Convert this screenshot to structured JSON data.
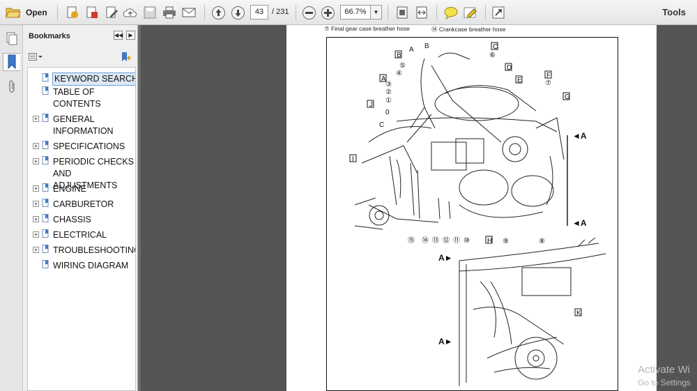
{
  "toolbar": {
    "open_label": "Open",
    "page_current": "43",
    "page_total": "/ 231",
    "zoom": "66.7%",
    "tools_label": "Tools",
    "icons": [
      "folder-open-icon",
      "create-pdf-icon",
      "export-pdf-icon",
      "edit-pdf-icon",
      "cloud-upload-icon",
      "save-icon",
      "print-icon",
      "email-icon",
      "previous-page-icon",
      "next-page-icon",
      "zoom-out-icon",
      "zoom-in-icon",
      "fit-page-icon",
      "fit-width-icon",
      "comment-icon",
      "highlight-icon",
      "fullscreen-icon"
    ]
  },
  "panel": {
    "title": "Bookmarks",
    "items": [
      {
        "label": "KEYWORD SEARCH",
        "expandable": false,
        "selected": true
      },
      {
        "label": "TABLE OF CONTENTS",
        "expandable": false
      },
      {
        "label": "GENERAL INFORMATION",
        "expandable": true
      },
      {
        "label": "SPECIFICATIONS",
        "expandable": true
      },
      {
        "label": "PERIODIC CHECKS AND ADJUSTMENTS",
        "expandable": true
      },
      {
        "label": "ENGINE",
        "expandable": true
      },
      {
        "label": "CARBURETOR",
        "expandable": true
      },
      {
        "label": "CHASSIS",
        "expandable": true
      },
      {
        "label": "ELECTRICAL",
        "expandable": true
      },
      {
        "label": "TROUBLESHOOTING",
        "expandable": true
      },
      {
        "label": "WIRING DIAGRAM",
        "expandable": false
      }
    ]
  },
  "document": {
    "caption_left": "⑦ Final gear case breather hose",
    "caption_right": "⑭ Crankcase breather hose",
    "callouts": {
      "letters": [
        "A",
        "B",
        "B",
        "C",
        "C",
        "D",
        "E",
        "F",
        "G",
        "H",
        "I",
        "J",
        "K",
        "A",
        "A",
        "A",
        "A"
      ],
      "numbers": [
        "①",
        "②",
        "③",
        "④",
        "⑤",
        "⑥",
        "⑦",
        "⑧",
        "⑨",
        "⑩",
        "⑪",
        "⑫",
        "⑬",
        "⑭",
        "⑮"
      ],
      "zero": "0"
    }
  },
  "watermark": {
    "line1": "Activate Wi",
    "line2": "Go to Settings"
  }
}
